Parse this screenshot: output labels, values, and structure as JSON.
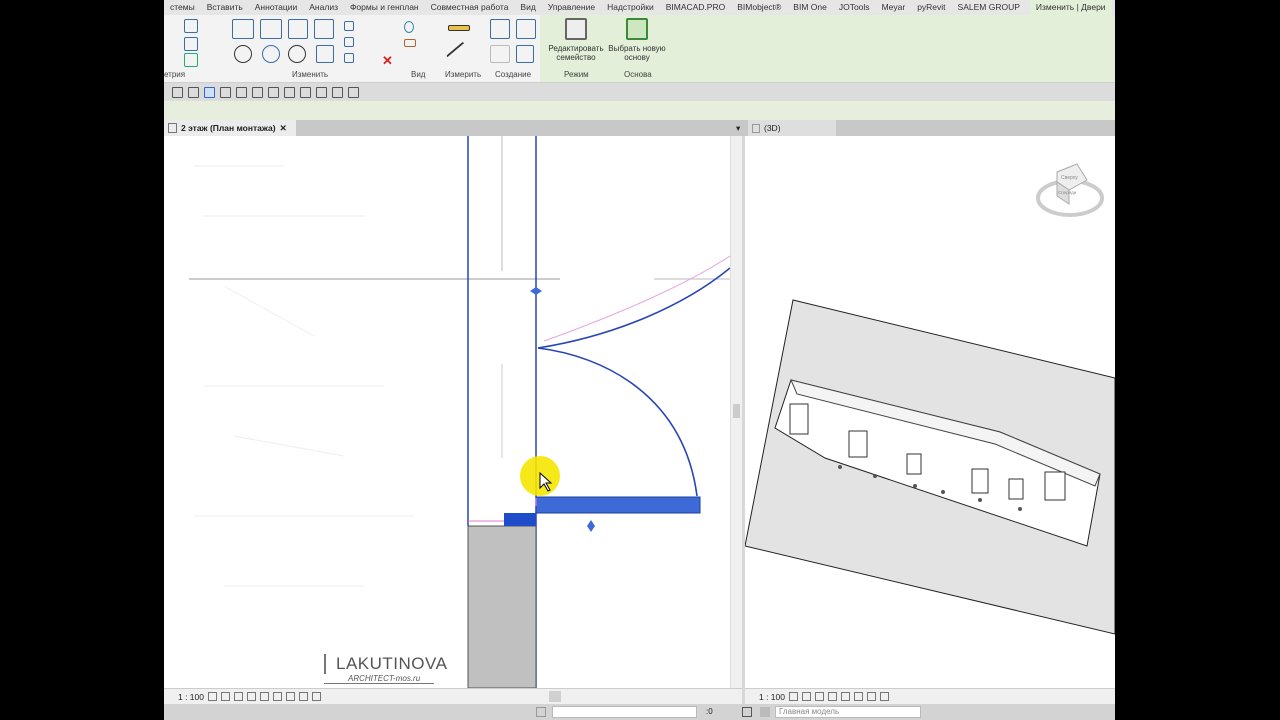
{
  "ribbon_tabs": [
    "стемы",
    "Вставить",
    "Аннотации",
    "Анализ",
    "Формы и генплан",
    "Совместная работа",
    "Вид",
    "Управление",
    "Надстройки",
    "BIMACAD.PRO",
    "BIMobject®",
    "BIM One",
    "JOTools",
    "Meyar",
    "pyRevit",
    "SALEM GROUP",
    "Изменить | Двери"
  ],
  "panels": {
    "geometry": "етрия",
    "modify": "Изменить",
    "view": "Вид",
    "measure": "Измерить",
    "create": "Создание",
    "mode": "Режим",
    "host": "Основа"
  },
  "buttons": {
    "edit_family": "Редактировать семейство",
    "pick_host": "Выбрать новую основу"
  },
  "views": {
    "plan_tab": "2 этаж (План монтажа)",
    "close": "✕",
    "threed_tab": "(3D)"
  },
  "viewbars": {
    "left_scale": "1 : 100",
    "right_scale": "1 : 100"
  },
  "watermark": {
    "name": "LAKUTINOVA",
    "site": "ARCHITECT-mos.ru"
  },
  "status": {
    "filter_count": ":0",
    "model": "Главная модель"
  },
  "viewcube": {
    "top": "Сверху",
    "front": "Спереди"
  }
}
